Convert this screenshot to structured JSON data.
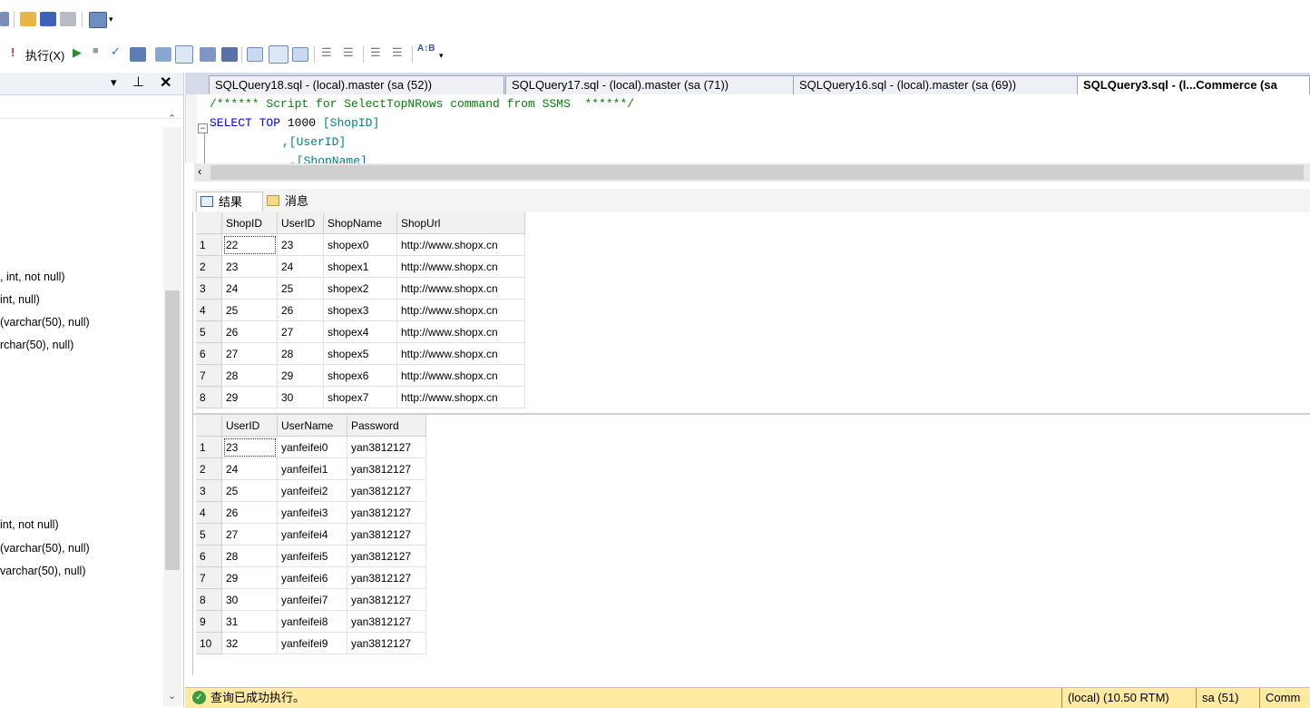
{
  "toolbar": {
    "execute_label": "执行(X)"
  },
  "object_explorer": {
    "column_lines_shop": [
      ", int, not null)",
      " int, null)",
      " (varchar(50), null)",
      "rchar(50), null)"
    ],
    "column_lines_user": [
      " int, not null)",
      "(varchar(50), null)",
      "varchar(50), null)"
    ]
  },
  "tabs": [
    {
      "label": "SQLQuery18.sql - (local).master (sa (52))"
    },
    {
      "label": "SQLQuery17.sql - (local).master (sa (71))"
    },
    {
      "label": "SQLQuery16.sql - (local).master (sa (69))"
    },
    {
      "label": "SQLQuery3.sql - (l...Commerce (sa"
    }
  ],
  "editor": {
    "line1": "/****** Script for SelectTopNRows command from SSMS  ******/",
    "line2_kw1": "SELECT",
    "line2_kw2": "TOP",
    "line2_num": "1000",
    "line2_col": "[ShopID]",
    "line3": ",[UserID]",
    "line4": ",[ShopName]"
  },
  "results_tabs": {
    "results": "结果",
    "messages": "消息"
  },
  "grid1": {
    "columns": [
      "ShopID",
      "UserID",
      "ShopName",
      "ShopUrl"
    ],
    "rows": [
      [
        "1",
        "22",
        "23",
        "shopex0",
        "http://www.shopx.cn"
      ],
      [
        "2",
        "23",
        "24",
        "shopex1",
        "http://www.shopx.cn"
      ],
      [
        "3",
        "24",
        "25",
        "shopex2",
        "http://www.shopx.cn"
      ],
      [
        "4",
        "25",
        "26",
        "shopex3",
        "http://www.shopx.cn"
      ],
      [
        "5",
        "26",
        "27",
        "shopex4",
        "http://www.shopx.cn"
      ],
      [
        "6",
        "27",
        "28",
        "shopex5",
        "http://www.shopx.cn"
      ],
      [
        "7",
        "28",
        "29",
        "shopex6",
        "http://www.shopx.cn"
      ],
      [
        "8",
        "29",
        "30",
        "shopex7",
        "http://www.shopx.cn"
      ]
    ]
  },
  "grid2": {
    "columns": [
      "UserID",
      "UserName",
      "Password"
    ],
    "rows": [
      [
        "1",
        "23",
        "yanfeifei0",
        "yan3812127"
      ],
      [
        "2",
        "24",
        "yanfeifei1",
        "yan3812127"
      ],
      [
        "3",
        "25",
        "yanfeifei2",
        "yan3812127"
      ],
      [
        "4",
        "26",
        "yanfeifei3",
        "yan3812127"
      ],
      [
        "5",
        "27",
        "yanfeifei4",
        "yan3812127"
      ],
      [
        "6",
        "28",
        "yanfeifei5",
        "yan3812127"
      ],
      [
        "7",
        "29",
        "yanfeifei6",
        "yan3812127"
      ],
      [
        "8",
        "30",
        "yanfeifei7",
        "yan3812127"
      ],
      [
        "9",
        "31",
        "yanfeifei8",
        "yan3812127"
      ],
      [
        "10",
        "32",
        "yanfeifei9",
        "yan3812127"
      ]
    ]
  },
  "status": {
    "message": "查询已成功执行。",
    "server": "(local) (10.50 RTM)",
    "user": "sa (51)",
    "db": "Comm"
  },
  "colors": {
    "status_bg": "#ffeaa1",
    "keyword": "#0000ff",
    "comment": "#008000",
    "identifier": "#008080"
  }
}
